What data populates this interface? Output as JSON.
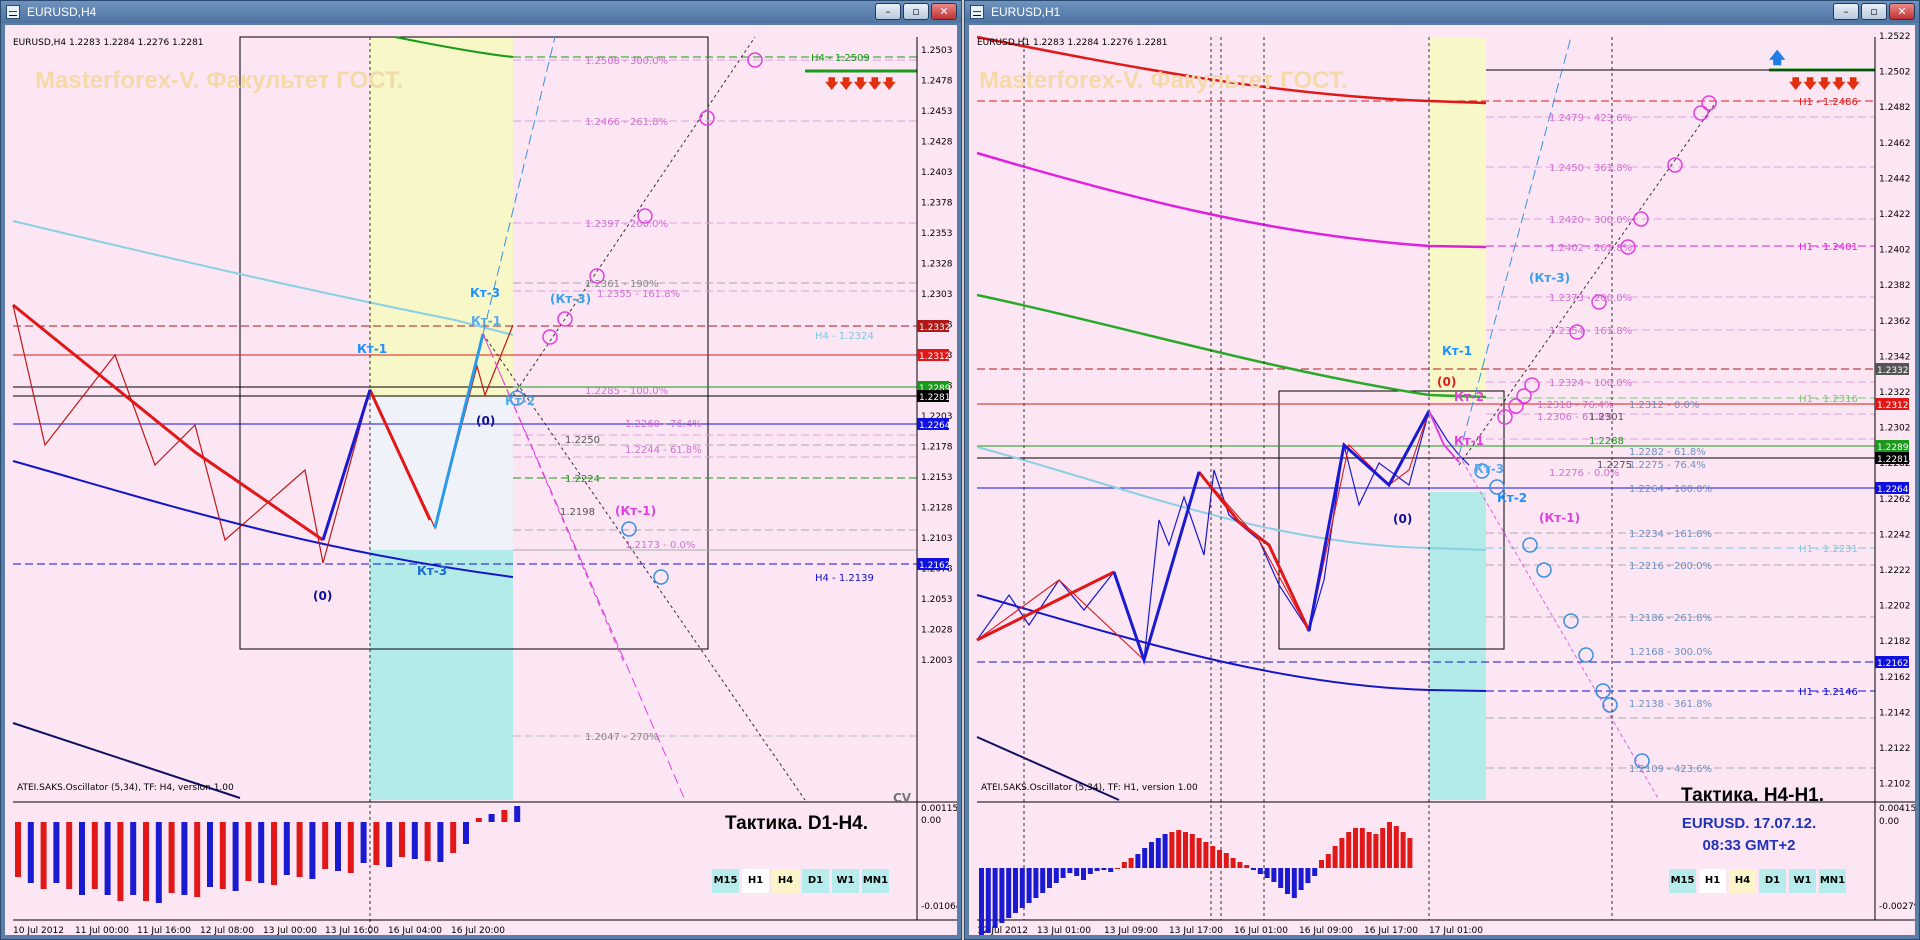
{
  "left": {
    "title": "EURUSD,H4",
    "ohlc": "EURUSD,H4  1.2283 1.2284 1.2276 1.2281",
    "watermark": "Masterforex-V. Факультет ГОСТ.",
    "tactic": "Тактика. D1-H4.",
    "cv": "CV",
    "indicator_title": "ATEI.SAKS.Oscillator (5,34), TF: H4, version 1.00",
    "timeframes": [
      "M15",
      "H1",
      "H4",
      "D1",
      "W1",
      "MN1"
    ],
    "price_ticks": [
      "1.2503",
      "1.2478",
      "1.2453",
      "1.2428",
      "1.2403",
      "1.2378",
      "1.2353",
      "1.2328",
      "1.2303",
      "1.2278",
      "1.2253",
      "1.2228",
      "1.2203",
      "1.2178",
      "1.2153",
      "1.2128",
      "1.2103",
      "1.2078",
      "1.2053",
      "1.2028",
      "1.2003"
    ],
    "price_tags": [
      {
        "text": "1.2332",
        "color": "#b01818"
      },
      {
        "text": "1.2312",
        "color": "#e01818"
      },
      {
        "text": "1.2289",
        "color": "#1a9a1a"
      },
      {
        "text": "1.2281",
        "color": "#000000"
      },
      {
        "text": "1.2264",
        "color": "#1010e0"
      },
      {
        "text": "1.2162",
        "color": "#1010e0"
      }
    ],
    "ind_ticks": [
      "0.00115",
      "0.00",
      "-0.01064"
    ],
    "time_ticks": [
      "10 Jul 2012",
      "11 Jul 00:00",
      "11 Jul 16:00",
      "12 Jul 08:00",
      "13 Jul 00:00",
      "13 Jul 16:00",
      "16 Jul 04:00",
      "16 Jul 20:00"
    ],
    "level_labels": [
      {
        "text": "1.2508 - 300.0%",
        "color": "#d070d0"
      },
      {
        "text": "1.2466 - 261.8%",
        "color": "#d070d0"
      },
      {
        "text": "1.2397 - 200.0%",
        "color": "#d070d0"
      },
      {
        "text": "1.2361 - 190%",
        "color": "#888888"
      },
      {
        "text": "1.2355 - 161.8%",
        "color": "#d070d0"
      },
      {
        "text": "1.2285 - 100.0%",
        "color": "#d070d0"
      },
      {
        "text": "1.2260 - 76.4%",
        "color": "#d070d0"
      },
      {
        "text": "1.2250",
        "color": "#555555"
      },
      {
        "text": "1.2244 - 61.8%",
        "color": "#d070d0"
      },
      {
        "text": "1.2224",
        "color": "#1a9a1a"
      },
      {
        "text": "1.2198",
        "color": "#555555"
      },
      {
        "text": "1.2173 - 0.0%",
        "color": "#d070d0"
      },
      {
        "text": "1.2047 - 270%",
        "color": "#888888"
      },
      {
        "text": "H4 - 1.2324",
        "color": "#7fc7e0"
      },
      {
        "text": "H4 - 1.2139",
        "color": "#1010d0"
      },
      {
        "text": "H4 - 1.2509",
        "color": "#1a9a1a"
      }
    ],
    "point_labels": [
      {
        "text": "Кт-1",
        "color": "#1e90ff"
      },
      {
        "text": "Кт-3",
        "color": "#1e90ff"
      },
      {
        "text": "Кт-1",
        "color": "#55aaee"
      },
      {
        "text": "(Кт-3)",
        "color": "#3aa0ee"
      },
      {
        "text": "(0)",
        "color": "#101090"
      },
      {
        "text": "(0)",
        "color": "#101090"
      },
      {
        "text": "(Кт-1)",
        "color": "#e040e0"
      },
      {
        "text": "Кт-3",
        "color": "#1a6ad0"
      },
      {
        "text": "Кт-2",
        "color": "#55aaee"
      }
    ]
  },
  "right": {
    "title": "EURUSD,H1",
    "ohlc": "EURUSD,H1  1.2283 1.2284 1.2276 1.2281",
    "watermark": "Masterforex-V. Факультет ГОСТ.",
    "tactic": "Тактика. H4-H1.",
    "info_line1": "EURUSD. 17.07.12.",
    "info_line2": "08:33  GMT+2",
    "indicator_title": "ATEI.SAKS.Oscillator (5,34), TF: H1, version 1.00",
    "timeframes": [
      "M15",
      "H1",
      "H4",
      "D1",
      "W1",
      "MN1"
    ],
    "price_ticks": [
      "1.2522",
      "1.2502",
      "1.2482",
      "1.2462",
      "1.2442",
      "1.2422",
      "1.2402",
      "1.2382",
      "1.2362",
      "1.2342",
      "1.2322",
      "1.2302",
      "1.2282",
      "1.2262",
      "1.2242",
      "1.2222",
      "1.2202",
      "1.2182",
      "1.2162",
      "1.2142",
      "1.2122",
      "1.2102"
    ],
    "price_tags": [
      {
        "text": "1.2332",
        "color": "#555555"
      },
      {
        "text": "1.2312",
        "color": "#e01818"
      },
      {
        "text": "1.2289",
        "color": "#1a9a1a"
      },
      {
        "text": "1.2281",
        "color": "#000000"
      },
      {
        "text": "1.2264",
        "color": "#1010e0"
      },
      {
        "text": "1.2162",
        "color": "#1010e0"
      }
    ],
    "ind_ticks": [
      "0.00415",
      "0.00",
      "-0.00279"
    ],
    "time_ticks": [
      "12 Jul 2012",
      "13 Jul 01:00",
      "13 Jul 09:00",
      "13 Jul 17:00",
      "16 Jul 01:00",
      "16 Jul 09:00",
      "16 Jul 17:00",
      "17 Jul 01:00"
    ],
    "level_labels": [
      {
        "text": "1.2479 - 423.6%",
        "color": "#d070d0"
      },
      {
        "text": "1.2450 - 361.8%",
        "color": "#d070d0"
      },
      {
        "text": "1.2420 - 300.0%",
        "color": "#d070d0"
      },
      {
        "text": "1.2402 - 261.8%",
        "color": "#d070d0"
      },
      {
        "text": "1.2373 - 200.0%",
        "color": "#d070d0"
      },
      {
        "text": "1.2354 - 161.8%",
        "color": "#d070d0"
      },
      {
        "text": "1.2324 - 100.0%",
        "color": "#d070d0"
      },
      {
        "text": "1.2318 - 76.4%",
        "color": "#d070d0"
      },
      {
        "text": "1.2306 - 61.8%",
        "color": "#d070d0"
      },
      {
        "text": "1.2312 - 0.0%",
        "color": "#7090c0"
      },
      {
        "text": "1.2301",
        "color": "#555555"
      },
      {
        "text": "1.2288",
        "color": "#1a9a1a"
      },
      {
        "text": "1.2275",
        "color": "#555555"
      },
      {
        "text": "1.2282 - 61.8%",
        "color": "#7090c0"
      },
      {
        "text": "1.2275 - 76.4%",
        "color": "#7090c0"
      },
      {
        "text": "1.2276 - 0.0%",
        "color": "#d070d0"
      },
      {
        "text": "1.2264 - 100.0%",
        "color": "#7090c0"
      },
      {
        "text": "1.2234 - 161.8%",
        "color": "#7090c0"
      },
      {
        "text": "1.2216 - 200.0%",
        "color": "#7090c0"
      },
      {
        "text": "1.2186 - 261.8%",
        "color": "#7090c0"
      },
      {
        "text": "1.2168 - 300.0%",
        "color": "#7090c0"
      },
      {
        "text": "1.2138 - 361.8%",
        "color": "#7090c0"
      },
      {
        "text": "1.2109 - 423.6%",
        "color": "#7090c0"
      },
      {
        "text": "H1 - 1.2486",
        "color": "#e01818"
      },
      {
        "text": "H1 - 1.2401",
        "color": "#e020e0"
      },
      {
        "text": "H1 - 1.2316",
        "color": "#7ac77a"
      },
      {
        "text": "H1 - 1.2231",
        "color": "#7fc7e0"
      },
      {
        "text": "H1 - 1.2146",
        "color": "#1010d0"
      }
    ],
    "point_labels": [
      {
        "text": "Кт-1",
        "color": "#1e90ff"
      },
      {
        "text": "(Кт-3)",
        "color": "#3aa0ee"
      },
      {
        "text": "(0)",
        "color": "#e02020"
      },
      {
        "text": "Кт-2",
        "color": "#e040e0"
      },
      {
        "text": "Кт-1",
        "color": "#e040e0"
      },
      {
        "text": "Кт-3",
        "color": "#55aaee"
      },
      {
        "text": "(0)",
        "color": "#101090"
      },
      {
        "text": "Кт-2",
        "color": "#1e90ff"
      },
      {
        "text": "(Кт-1)",
        "color": "#e040e0"
      }
    ]
  }
}
